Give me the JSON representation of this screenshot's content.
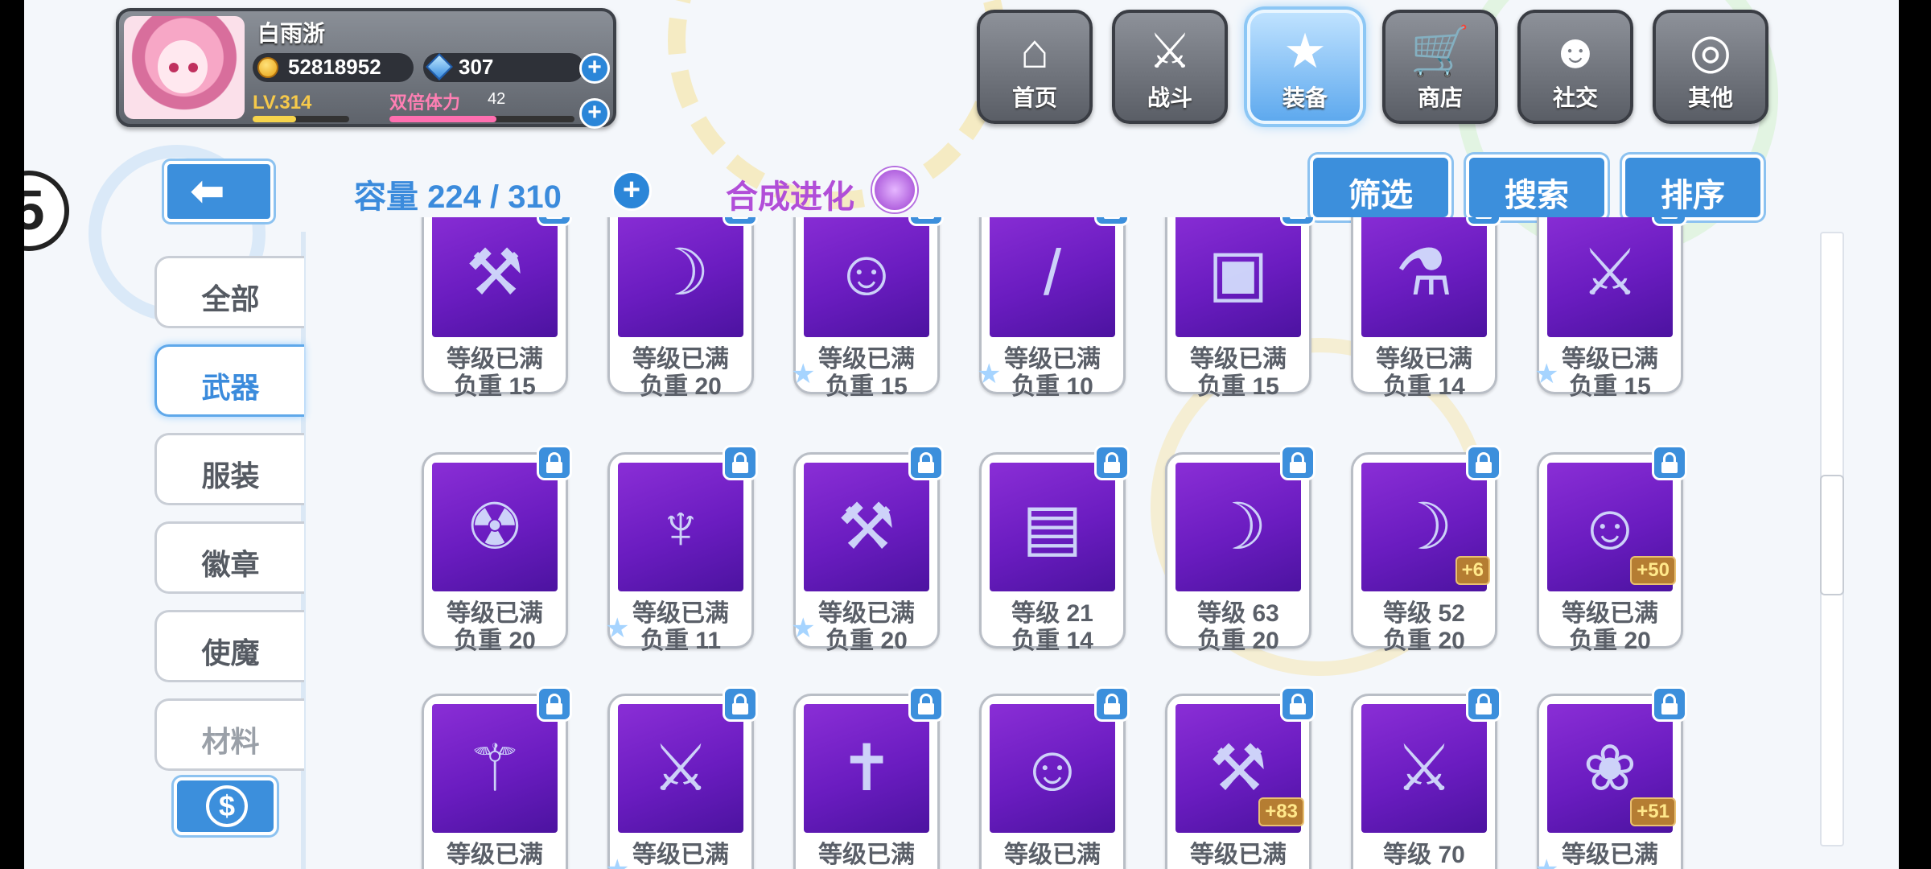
{
  "player": {
    "name": "白雨浙",
    "gold": "52818952",
    "gems": "307",
    "level": "LV.314",
    "level_progress": 0.45,
    "stamina_label": "双倍体力",
    "stamina_value": "42",
    "stamina_progress": 0.58
  },
  "nav": [
    {
      "label": "首页",
      "icon": "home-icon",
      "glyph": "⌂"
    },
    {
      "label": "战斗",
      "icon": "battle-icon",
      "glyph": "⚔"
    },
    {
      "label": "装备",
      "icon": "equipment-icon",
      "glyph": "★"
    },
    {
      "label": "商店",
      "icon": "shop-icon",
      "glyph": "🛒"
    },
    {
      "label": "社交",
      "icon": "social-icon",
      "glyph": "☻"
    },
    {
      "label": "其他",
      "icon": "other-icon",
      "glyph": "◎"
    }
  ],
  "nav_active": "装备",
  "side_badge": "5",
  "categories": [
    {
      "label": "全部",
      "state": "normal"
    },
    {
      "label": "武器",
      "state": "active"
    },
    {
      "label": "服装",
      "state": "normal"
    },
    {
      "label": "徽章",
      "state": "normal"
    },
    {
      "label": "使魔",
      "state": "normal"
    },
    {
      "label": "材料",
      "state": "faded"
    }
  ],
  "capacity": "容量 224 / 310",
  "fuse_label": "合成进化",
  "toolbar": {
    "filter": "筛选",
    "search": "搜索",
    "sort": "排序"
  },
  "items": [
    [
      {
        "level": "等级已满",
        "weight": "负重 15",
        "icon": "gun-icon",
        "glyph": "⚒",
        "star": false
      },
      {
        "level": "等级已满",
        "weight": "负重 20",
        "icon": "scythe-icon",
        "glyph": "☽",
        "star": false
      },
      {
        "level": "等级已满",
        "weight": "负重 15",
        "icon": "purple-hair-girl-icon",
        "glyph": "☺",
        "star": true
      },
      {
        "level": "等级已满",
        "weight": "负重 10",
        "icon": "sword-icon",
        "glyph": "/",
        "star": true
      },
      {
        "level": "等级已满",
        "weight": "负重 15",
        "icon": "mech-armor-icon",
        "glyph": "▣",
        "star": false
      },
      {
        "level": "等级已满",
        "weight": "负重 14",
        "icon": "potion-bottle-icon",
        "glyph": "⚗",
        "star": false
      },
      {
        "level": "等级已满",
        "weight": "负重 15",
        "icon": "rifle-icon",
        "glyph": "⚔",
        "star": true
      }
    ],
    [
      {
        "level": "等级已满",
        "weight": "负重 20",
        "icon": "gasmask-girl-icon",
        "glyph": "☢",
        "star": false,
        "badge": ""
      },
      {
        "level": "等级已满",
        "weight": "负重 11",
        "icon": "dark-greatsword-icon",
        "glyph": "♆",
        "star": true,
        "badge": ""
      },
      {
        "level": "等级已满",
        "weight": "负重 20",
        "icon": "lava-blade-icon",
        "glyph": "⚒",
        "star": true,
        "badge": ""
      },
      {
        "level": "等级 21",
        "weight": "负重 14",
        "icon": "robot-device-icon",
        "glyph": "▤",
        "star": false,
        "badge": ""
      },
      {
        "level": "等级 63",
        "weight": "负重 20",
        "icon": "green-scythe-icon",
        "glyph": "☽",
        "star": false,
        "badge": ""
      },
      {
        "level": "等级 52",
        "weight": "负重 20",
        "icon": "green-scythe-icon",
        "glyph": "☽",
        "star": false,
        "badge": "+6"
      },
      {
        "level": "等级已满",
        "weight": "负重 20",
        "icon": "blonde-girl-icon",
        "glyph": "☺",
        "star": false,
        "badge": "+50"
      }
    ],
    [
      {
        "level": "等级已满",
        "weight": "",
        "icon": "winged-spear-icon",
        "glyph": "⚚",
        "star": false,
        "badge": ""
      },
      {
        "level": "等级已满",
        "weight": "",
        "icon": "red-dark-blade-icon",
        "glyph": "⚔",
        "star": true,
        "badge": ""
      },
      {
        "level": "等级已满",
        "weight": "",
        "icon": "cross-icon",
        "glyph": "✝",
        "star": false,
        "badge": ""
      },
      {
        "level": "等级已满",
        "weight": "",
        "icon": "dark-haired-girl-icon",
        "glyph": "☺",
        "star": false,
        "badge": ""
      },
      {
        "level": "等级已满",
        "weight": "",
        "icon": "heavy-gun-icon",
        "glyph": "⚒",
        "star": false,
        "badge": "+83"
      },
      {
        "level": "等级 70",
        "weight": "",
        "icon": "dark-rifle-icon",
        "glyph": "⚔",
        "star": false,
        "badge": ""
      },
      {
        "level": "等级已满",
        "weight": "",
        "icon": "lotus-lantern-icon",
        "glyph": "❀",
        "star": true,
        "badge": "+51"
      }
    ]
  ],
  "colors": {
    "accent": "#3c8fdc",
    "card_art": "#7a25cc",
    "fuse": "#b14ed8",
    "bonus_badge": "#b57d32"
  }
}
